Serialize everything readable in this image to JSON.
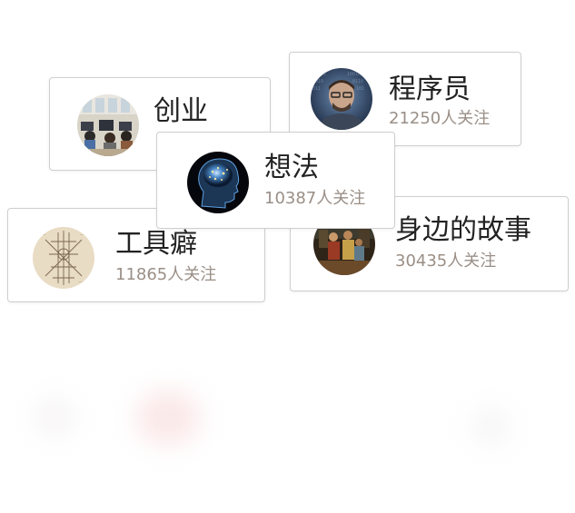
{
  "topics": [
    {
      "name": "创业",
      "followers": "",
      "avatar_icon": "office-team-photo-icon"
    },
    {
      "name": "程序员",
      "followers": "21250人关注",
      "avatar_icon": "programmer-photo-icon"
    },
    {
      "name": "想法",
      "followers": "10387人关注",
      "avatar_icon": "brain-scan-icon"
    },
    {
      "name": "工具癖",
      "followers": "11865人关注",
      "avatar_icon": "sketch-blueprint-icon"
    },
    {
      "name": "身边的故事",
      "followers": "30435人关注",
      "avatar_icon": "street-scene-photo-icon"
    }
  ],
  "colors": {
    "title": "#222222",
    "followers": "#9a8f87",
    "card_border": "#cfcfcf"
  }
}
